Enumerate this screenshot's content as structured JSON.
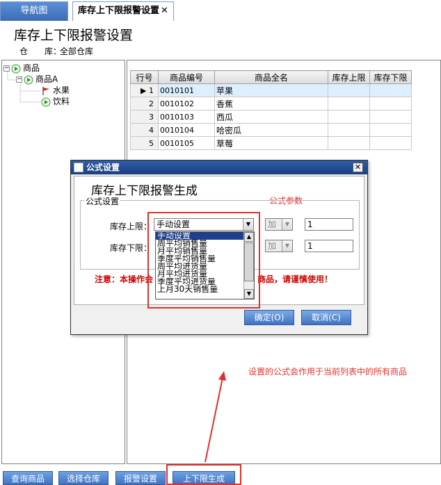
{
  "tabs": [
    {
      "label": "导航图"
    },
    {
      "label": "库存上下限报警设置",
      "close": "✕"
    }
  ],
  "page": {
    "title": "库存上下限报警设置",
    "warehouse_label": "仓　　库：",
    "warehouse_value": "全部仓库"
  },
  "tree": {
    "root": "商品",
    "child": "商品A",
    "leaves": [
      "水果",
      "饮料"
    ]
  },
  "grid": {
    "columns": [
      "行号",
      "商品编号",
      "商品全名",
      "库存上限",
      "库存下限"
    ],
    "rows": [
      {
        "no": "1",
        "code": "0010101",
        "name": "苹果"
      },
      {
        "no": "2",
        "code": "0010102",
        "name": "香蕉"
      },
      {
        "no": "3",
        "code": "0010103",
        "name": "西瓜"
      },
      {
        "no": "4",
        "code": "0010104",
        "name": "哈密瓜"
      },
      {
        "no": "5",
        "code": "0010105",
        "name": "草莓"
      }
    ]
  },
  "bottom_buttons": [
    "查询商品",
    "选择仓库",
    "报警设置",
    "上下限生成"
  ],
  "dialog": {
    "title": "公式设置",
    "heading": "库存上下限报警生成",
    "formula_param_label": "公式参数",
    "group_label": "公式设置",
    "upper_label": "库存上限：",
    "lower_label": "库存下限：",
    "upper_combo": "手动设置",
    "op_upper": "加",
    "op_lower": "加",
    "upper_value": "1",
    "lower_value": "1",
    "dropdown_options": [
      "手动设置",
      "周平均销售量",
      "月平均销售量",
      "季度平均销售量",
      "周平均进货量",
      "月平均进货量",
      "季度平均进货量",
      "上月30天销售量"
    ],
    "warning_left": "注意：本操作会",
    "warning_right": "商品，请谨慎使用！",
    "ok_label": "确定(O)",
    "cancel_label": "取消(C)"
  },
  "annotation": {
    "text": "设置的公式会作用于当前列表中的所有商品"
  },
  "colors": {
    "accent_red": "#e0302a",
    "button_blue": "#3f73c2",
    "titlebar_blue": "#1b3f7e"
  }
}
